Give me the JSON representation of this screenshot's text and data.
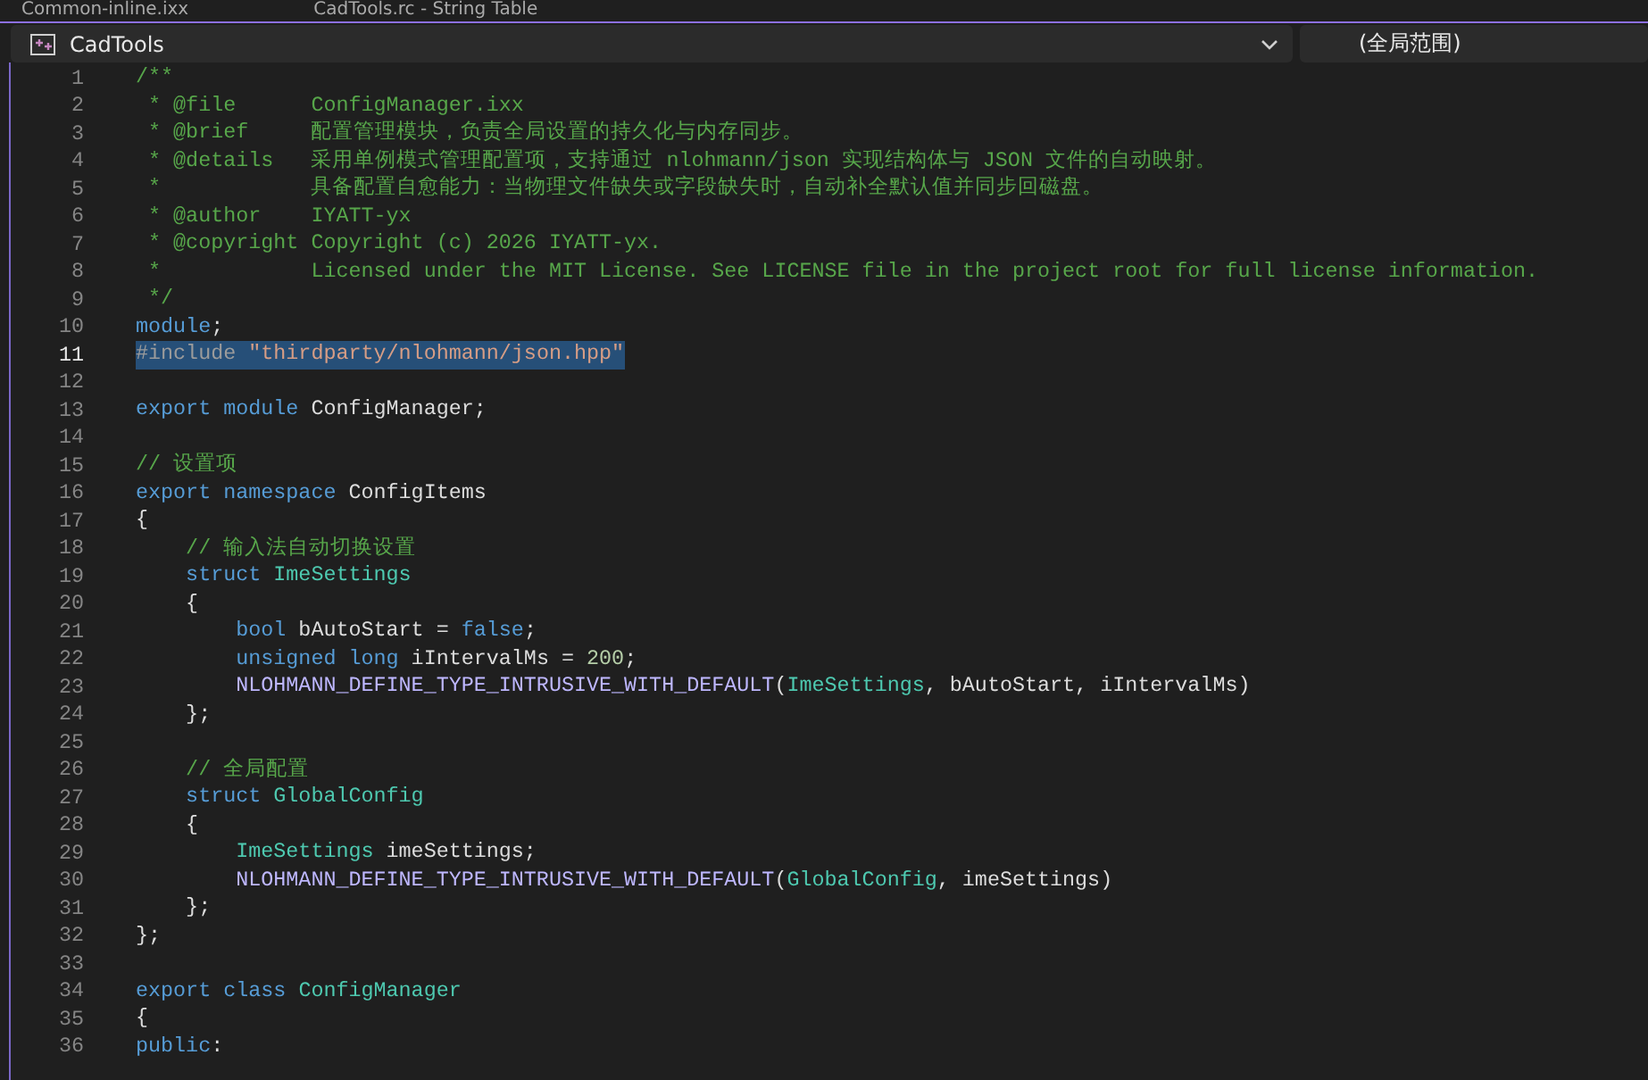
{
  "tabs": [
    {
      "label": "Common-inline.ixx",
      "selected": false
    },
    {
      "label": "CadTools.rc - String Table",
      "selected": false
    }
  ],
  "navigation_bar": {
    "project": "CadTools",
    "scope": "(全局范围)"
  },
  "editor": {
    "lines": [
      {
        "number": "1",
        "tokens": [
          {
            "kind": "comment",
            "text": "/**"
          }
        ]
      },
      {
        "number": "2",
        "tokens": [
          {
            "kind": "comment",
            "text": " * @file      ConfigManager.ixx"
          }
        ]
      },
      {
        "number": "3",
        "tokens": [
          {
            "kind": "comment",
            "text": " * @brief     配置管理模块，负责全局设置的持久化与内存同步。"
          }
        ]
      },
      {
        "number": "4",
        "tokens": [
          {
            "kind": "comment",
            "text": " * @details   采用单例模式管理配置项，支持通过 nlohmann/json 实现结构体与 JSON 文件的自动映射。"
          }
        ]
      },
      {
        "number": "5",
        "tokens": [
          {
            "kind": "comment",
            "text": " *            具备配置自愈能力：当物理文件缺失或字段缺失时，自动补全默认值并同步回磁盘。"
          }
        ]
      },
      {
        "number": "6",
        "tokens": [
          {
            "kind": "comment",
            "text": " * @author    IYATT-yx"
          }
        ]
      },
      {
        "number": "7",
        "tokens": [
          {
            "kind": "comment",
            "text": " * @copyright Copyright (c) 2026 IYATT-yx."
          }
        ]
      },
      {
        "number": "8",
        "tokens": [
          {
            "kind": "comment",
            "text": " *            Licensed under the MIT License. See LICENSE file in the project root for full license information."
          }
        ]
      },
      {
        "number": "9",
        "tokens": [
          {
            "kind": "comment",
            "text": " */"
          }
        ]
      },
      {
        "number": "10",
        "tokens": [
          {
            "kind": "keyword",
            "text": "module"
          },
          {
            "kind": "plain",
            "text": ";"
          }
        ]
      },
      {
        "number": "11",
        "selected": true,
        "tokens": [
          {
            "kind": "preprocessor",
            "text": "#include "
          },
          {
            "kind": "string",
            "text": "\"thirdparty/nlohmann/json.hpp\""
          }
        ]
      },
      {
        "number": "12"
      },
      {
        "number": "13",
        "tokens": [
          {
            "kind": "keyword",
            "text": "export module"
          },
          {
            "kind": "plain",
            "text": " ConfigManager;"
          }
        ]
      },
      {
        "number": "14"
      },
      {
        "number": "15",
        "tokens": [
          {
            "kind": "comment",
            "text": "// 设置项"
          }
        ]
      },
      {
        "number": "16",
        "tokens": [
          {
            "kind": "keyword",
            "text": "export namespace"
          },
          {
            "kind": "plain",
            "text": " ConfigItems"
          }
        ]
      },
      {
        "number": "17",
        "tokens": [
          {
            "kind": "plain",
            "text": "{"
          }
        ]
      },
      {
        "number": "18",
        "tokens": [
          {
            "kind": "comment",
            "text": "    // 输入法自动切换设置"
          }
        ]
      },
      {
        "number": "19",
        "tokens": [
          {
            "kind": "keyword",
            "text": "    struct "
          },
          {
            "kind": "type",
            "text": "ImeSettings"
          }
        ]
      },
      {
        "number": "20",
        "tokens": [
          {
            "kind": "plain",
            "text": "    {"
          }
        ]
      },
      {
        "number": "21",
        "tokens": [
          {
            "kind": "keyword",
            "text": "        bool"
          },
          {
            "kind": "plain",
            "text": " bAutoStart = "
          },
          {
            "kind": "keyword",
            "text": "false"
          },
          {
            "kind": "plain",
            "text": ";"
          }
        ]
      },
      {
        "number": "22",
        "tokens": [
          {
            "kind": "keyword",
            "text": "        unsigned long"
          },
          {
            "kind": "plain",
            "text": " iIntervalMs = "
          },
          {
            "kind": "number",
            "text": "200"
          },
          {
            "kind": "plain",
            "text": ";"
          }
        ]
      },
      {
        "number": "23",
        "tokens": [
          {
            "kind": "macro",
            "text": "        NLOHMANN_DEFINE_TYPE_INTRUSIVE_WITH_DEFAULT"
          },
          {
            "kind": "plain",
            "text": "("
          },
          {
            "kind": "type",
            "text": "ImeSettings"
          },
          {
            "kind": "plain",
            "text": ", bAutoStart, iIntervalMs)"
          }
        ]
      },
      {
        "number": "24",
        "tokens": [
          {
            "kind": "plain",
            "text": "    };"
          }
        ]
      },
      {
        "number": "25"
      },
      {
        "number": "26",
        "tokens": [
          {
            "kind": "comment",
            "text": "    // 全局配置"
          }
        ]
      },
      {
        "number": "27",
        "tokens": [
          {
            "kind": "keyword",
            "text": "    struct "
          },
          {
            "kind": "type",
            "text": "GlobalConfig"
          }
        ]
      },
      {
        "number": "28",
        "tokens": [
          {
            "kind": "plain",
            "text": "    {"
          }
        ]
      },
      {
        "number": "29",
        "tokens": [
          {
            "kind": "type",
            "text": "        ImeSettings"
          },
          {
            "kind": "plain",
            "text": " imeSettings;"
          }
        ]
      },
      {
        "number": "30",
        "tokens": [
          {
            "kind": "macro",
            "text": "        NLOHMANN_DEFINE_TYPE_INTRUSIVE_WITH_DEFAULT"
          },
          {
            "kind": "plain",
            "text": "("
          },
          {
            "kind": "type",
            "text": "GlobalConfig"
          },
          {
            "kind": "plain",
            "text": ", imeSettings)"
          }
        ]
      },
      {
        "number": "31",
        "tokens": [
          {
            "kind": "plain",
            "text": "    };"
          }
        ]
      },
      {
        "number": "32",
        "tokens": [
          {
            "kind": "plain",
            "text": "};"
          }
        ]
      },
      {
        "number": "33"
      },
      {
        "number": "34",
        "tokens": [
          {
            "kind": "keyword",
            "text": "export class "
          },
          {
            "kind": "type",
            "text": "ConfigManager"
          }
        ]
      },
      {
        "number": "35",
        "tokens": [
          {
            "kind": "plain",
            "text": "{"
          }
        ]
      },
      {
        "number": "36",
        "tokens": [
          {
            "kind": "keyword",
            "text": "public"
          },
          {
            "kind": "plain",
            "text": ":"
          }
        ]
      }
    ]
  }
}
